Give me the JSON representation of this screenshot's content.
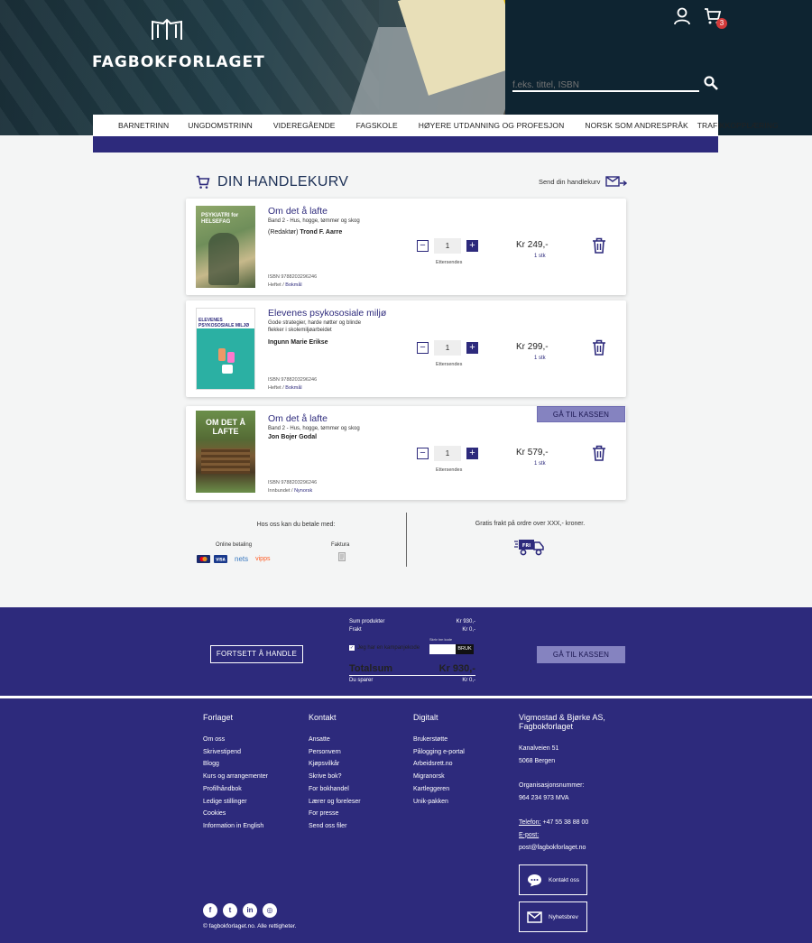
{
  "header": {
    "brand": "FAGBOKFORLAGET",
    "cart_count": "3",
    "search_placeholder": "f.eks. tittel, ISBN"
  },
  "nav": {
    "items": [
      "BARNETRINN",
      "UNGDOMSTRINN",
      "VIDEREGÅENDE",
      "FAGSKOLE",
      "HØYERE UTDANNING OG PROFESJON",
      "NORSK SOM ANDRESPRÅK",
      "TRAFIKKOPPLÆRING"
    ]
  },
  "cart": {
    "title": "DIN HANDLEKURV",
    "send_label": "Send din handlekurv",
    "checkout_label": "GÅ TIL KASSEN",
    "items": [
      {
        "title": "Om det å lafte",
        "subtitle": "Band 2 - Hus, hogge, tømmer og skog",
        "author_role": "(Redaktør)",
        "author": "Trond F. Aarre",
        "isbn": "ISBN 9788203296246",
        "format": "Heftet",
        "language": "Bokmål",
        "qty": "1",
        "eta": "Ettersendes",
        "price": "Kr 249,-",
        "pcs": "1 stk",
        "cover_text": "PSYKIATRI for HELSEFAG"
      },
      {
        "title": "Elevenes psykososiale miljø",
        "subtitle": "Gode strategier, harde nøtter og blinde flekker i skolemiljøarbeidet",
        "author_role": "",
        "author": "Ingunn Marie Erikse",
        "isbn": "ISBN 9788203296246",
        "format": "Heftet",
        "language": "Bokmål",
        "qty": "1",
        "eta": "Ettersendes",
        "price": "Kr 299,-",
        "pcs": "1 stk",
        "cover_text": "ELEVENES PSYKOSOSIALE MILJØ"
      },
      {
        "title": "Om det å lafte",
        "subtitle": "Band 2 - Hus, hogge, tømmer og skog",
        "author_role": "",
        "author": "Jon Bojer Godal",
        "isbn": "ISBN 9788203296246",
        "format": "Innbundet",
        "language": "Nynorsk",
        "qty": "1",
        "eta": "Ettersendes",
        "price": "Kr 579,-",
        "pcs": "1 stk",
        "cover_text": "OM DET Å LAFTE"
      }
    ]
  },
  "payment": {
    "title": "Hos oss kan du betale med:",
    "online": "Online betaling",
    "invoice": "Faktura",
    "nets": "nets",
    "vipps": "vipps",
    "free_shipping": "Gratis frakt på ordre over XXX,- kroner.",
    "truck_label": "FRI"
  },
  "summary": {
    "continue_label": "FORTSETT Å HANDLE",
    "checkout_label": "GÅ TIL KASSEN",
    "sum_label": "Sum produkter",
    "sum_value": "Kr 930,-",
    "freight_label": "Frakt",
    "freight_value": "Kr 0,-",
    "promo_label": "Jeg har en kampanjekode",
    "promo_hint": "Skriv inn kode",
    "promo_button": "BRUK",
    "total_label": "Totalsum",
    "total_value": "Kr 930,-",
    "saved_label": "Du sparer",
    "saved_value": "Kr 0,-"
  },
  "footer": {
    "forlaget": {
      "title": "Forlaget",
      "links": [
        "Om oss",
        "Skrivestipend",
        "Blogg",
        "Kurs og arrangementer",
        "Profilhåndbok",
        "Ledige stillinger",
        "Cookies",
        "Information in English"
      ]
    },
    "kontakt": {
      "title": "Kontakt",
      "links": [
        "Ansatte",
        "Personvern",
        "Kjøpsvilkår",
        "Skrive bok?",
        "For bokhandel",
        "Lærer og foreleser",
        "For presse",
        "Send oss filer"
      ]
    },
    "digitalt": {
      "title": "Digitalt",
      "links": [
        "Brukerstøtte",
        "Pålogging e-portal",
        "Arbeidsrett.no",
        "Migranorsk",
        "Kartleggeren",
        "Unik-pakken"
      ]
    },
    "company": {
      "name_line1": "Vigmostad & Bjørke AS,",
      "name_line2": "Fagbokforlaget",
      "address1": "Kanalveien 51",
      "address2": "5068 Bergen",
      "org_label": "Organisasjonsnummer:",
      "org_value": "964 234 973 MVA",
      "phone_label": "Telefon:",
      "phone_value": "+47 55 38 88 00",
      "email_label": "E-post:",
      "email_value": "post@fagbokforlaget.no"
    },
    "contact_button": "Kontakt oss",
    "newsletter_button": "Nyhetsbrev",
    "copyright": "© fagbokforlaget.no. Alle rettigheter."
  },
  "colors": {
    "brand": "#2d2a7c",
    "checkout": "#8583c0",
    "badge": "#d23a3a"
  }
}
